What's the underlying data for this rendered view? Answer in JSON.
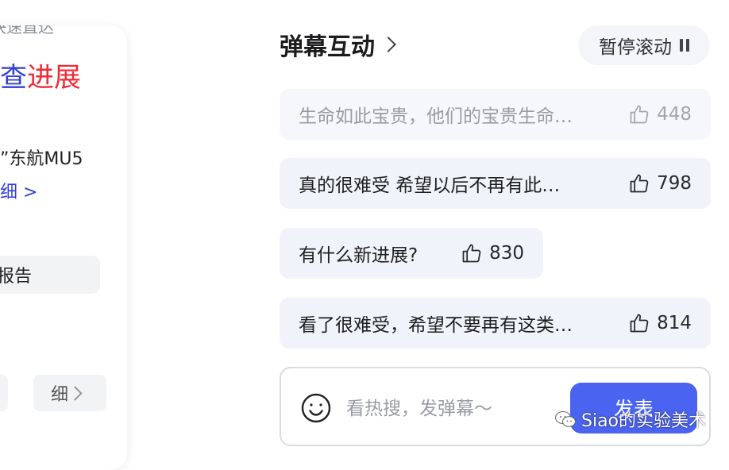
{
  "left_card": {
    "top_cut_text": "快速直达",
    "progress_title_part1": "查",
    "progress_title_part2": "进展",
    "news_line": "”东航MU5",
    "news_detail": "细 >",
    "report_label": "报告",
    "detail_label": "细"
  },
  "danmu_section": {
    "title": "弹幕互动",
    "pause_label": "暂停滚动",
    "items": [
      {
        "text": "生命如此宝贵，他们的宝贵生命…",
        "likes": "448"
      },
      {
        "text": "真的很难受 希望以后不再有此…",
        "likes": "798"
      },
      {
        "text": "有什么新进展?",
        "likes": "830"
      },
      {
        "text": "看了很难受，希望不要再有这类…",
        "likes": "814"
      }
    ]
  },
  "input": {
    "placeholder": "看热搜，发弹幕～",
    "send_label": "发表"
  },
  "watermark": {
    "text": "Siao的实验美术"
  },
  "colors": {
    "accent_blue": "#4a63f0",
    "title_blue": "#2f3fd6",
    "title_red": "#ef2a36",
    "bubble_bg": "#f1f3fb"
  }
}
